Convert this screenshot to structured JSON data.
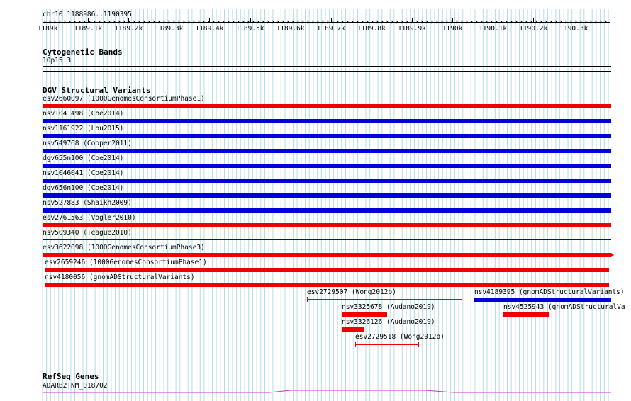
{
  "header": {
    "location": "chr10:1188986..1190395",
    "tick_labels": [
      "1189k",
      "1189.1k",
      "1189.2k",
      "1189.3k",
      "1189.4k",
      "1189.5k",
      "1189.6k",
      "1189.7k",
      "1189.8k",
      "1189.9k",
      "1190k",
      "1190.1k",
      "1190.2k",
      "1190.3k"
    ]
  },
  "cytobands": {
    "title": "Cytogenetic Bands",
    "band": "10p15.3"
  },
  "dgv": {
    "title": "DGV Structural Variants",
    "variants": [
      {
        "label": "esv2660097 (1000GenomesConsortiumPhase1)",
        "color": "#ee0000"
      },
      {
        "label": "nsv1041498 (Coe2014)",
        "color": "#0000dd"
      },
      {
        "label": "nsv1161922 (Lou2015)",
        "color": "#0000dd"
      },
      {
        "label": "nsv549768 (Cooper2011)",
        "color": "#0000dd"
      },
      {
        "label": "dgv655n100 (Coe2014)",
        "color": "#0000dd"
      },
      {
        "label": "nsv1046041 (Coe2014)",
        "color": "#0000dd"
      },
      {
        "label": "dgv656n100 (Coe2014)",
        "color": "#0000dd"
      },
      {
        "label": "nsv527883 (Shaikh2009)",
        "color": "#0000dd"
      },
      {
        "label": "esv2761563 (Vogler2010)",
        "color": "#ee0000"
      },
      {
        "label": "nsv509340 (Teague2010)",
        "color": "#0000dd"
      },
      {
        "label": "esv3622098 (1000GenomesConsortiumPhase3)",
        "color": "#ee0000"
      },
      {
        "label": "esv2659246 (1000GenomesConsortiumPhase1)",
        "color": "#ee0000"
      },
      {
        "label": "nsv4180056 (gnomADStructuralVariants)",
        "color": "#ee0000"
      },
      {
        "label": "esv2729507 (Wong2012b)",
        "color": "#ee0000"
      },
      {
        "label": "nsv4189395 (gnomADStructuralVariants)",
        "color": "#0000dd"
      },
      {
        "label": "nsv3325678 (Audano2019)",
        "color": "#ee0000"
      },
      {
        "label": "nsv4525943 (gnomADStructuralVa",
        "color": "#ee0000"
      },
      {
        "label": "nsv3326126 (Audano2019)",
        "color": "#ee0000"
      },
      {
        "label": "esv2729518 (Wong2012b)",
        "color": "#ee0000"
      }
    ]
  },
  "refseq": {
    "title": "RefSeq Genes",
    "gene": "ADARB2|NM_018702",
    "gene_color": "#cc33cc"
  },
  "colors": {
    "grid": "#b6dbe3",
    "gain": "#0000dd",
    "loss": "#ee0000"
  }
}
